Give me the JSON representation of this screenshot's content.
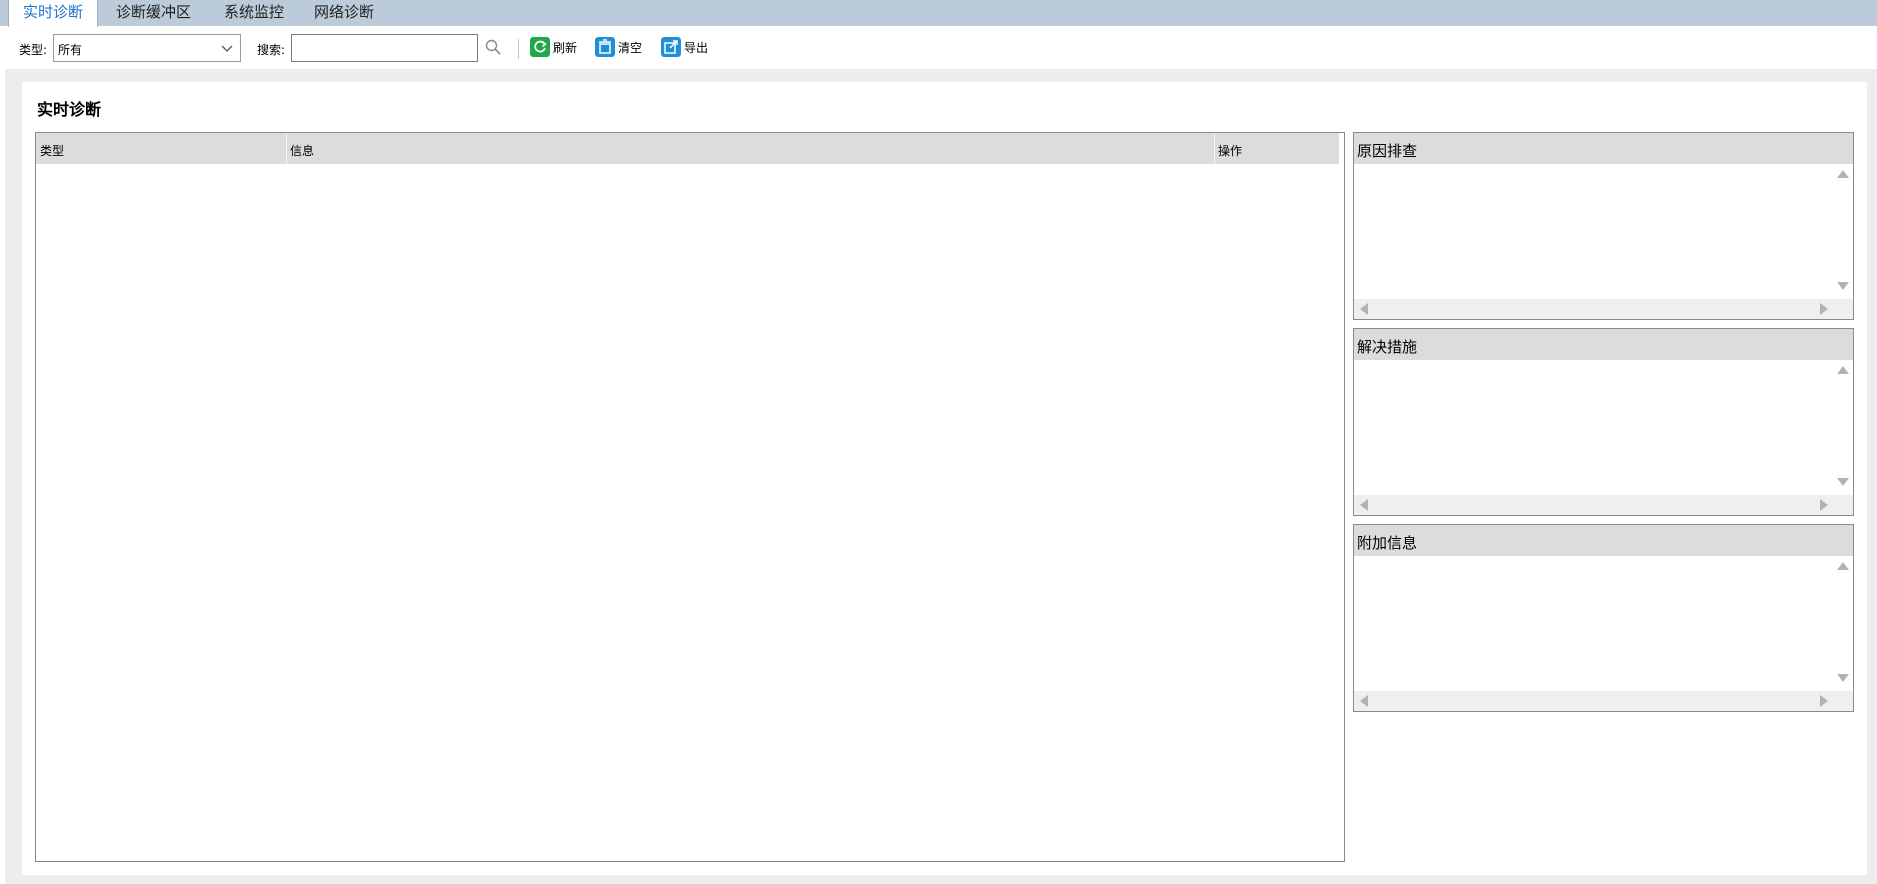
{
  "tabs": [
    {
      "label": "实时诊断",
      "active": true
    },
    {
      "label": "诊断缓冲区",
      "active": false
    },
    {
      "label": "系统监控",
      "active": false
    },
    {
      "label": "网络诊断",
      "active": false
    }
  ],
  "toolbar": {
    "type_label": "类型:",
    "type_value": "所有",
    "search_label": "搜索:",
    "search_value": "",
    "refresh_label": "刷新",
    "clear_label": "清空",
    "export_label": "导出"
  },
  "main": {
    "title": "实时诊断",
    "columns": [
      "类型",
      "信息",
      "操作"
    ],
    "rows": []
  },
  "panels": [
    {
      "title": "原因排查"
    },
    {
      "title": "解决措施"
    },
    {
      "title": "附加信息"
    }
  ],
  "colors": {
    "tab_bar": "#bccbd9",
    "active_tab_text": "#1a73d1",
    "header_bg": "#dcdcdc",
    "refresh_icon": "#1fa84a",
    "clear_icon": "#1e8fd8",
    "export_icon": "#1e8fd8"
  }
}
